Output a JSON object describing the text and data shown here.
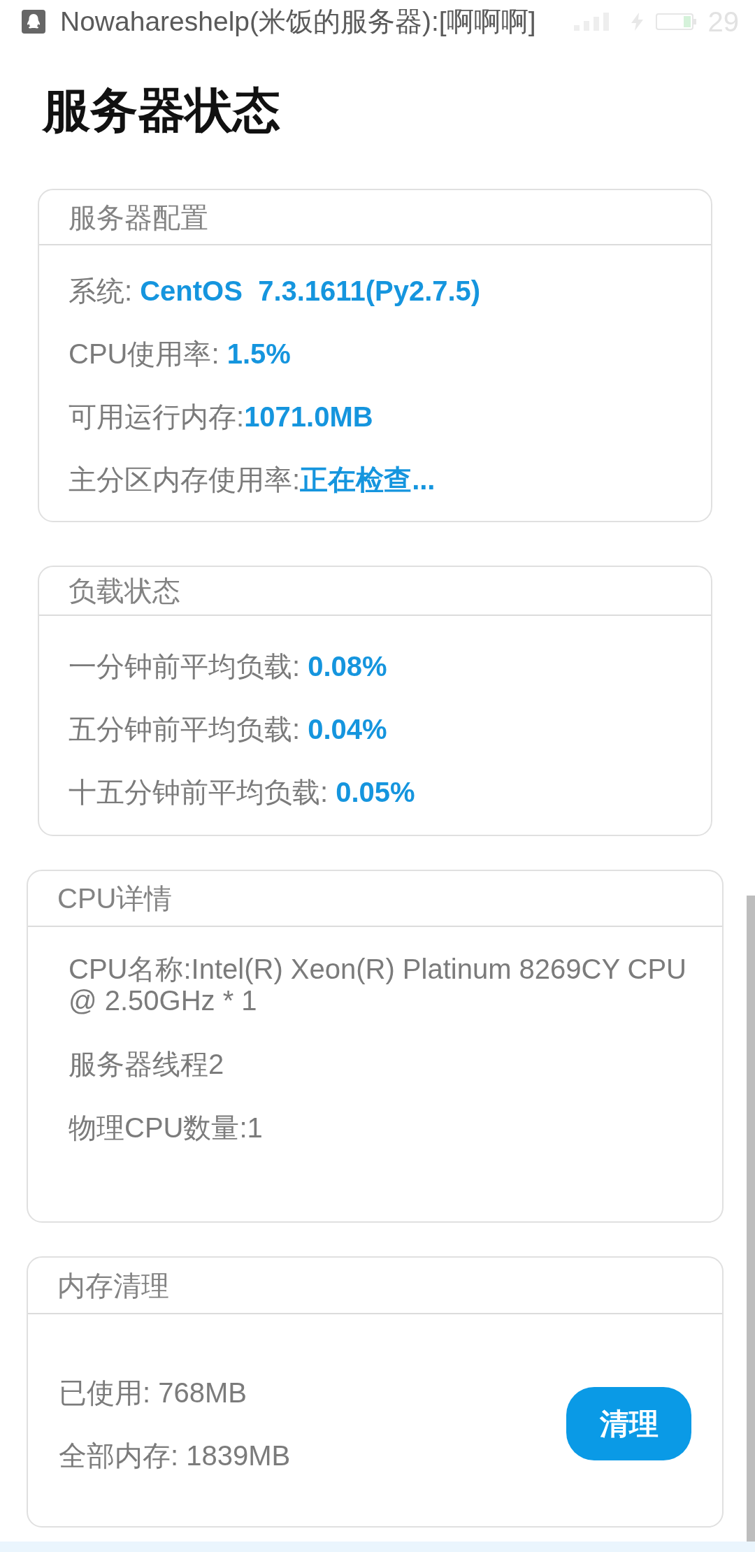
{
  "status_bar": {
    "notification": "Nowahareshelp(米饭的服务器):[啊啊啊]",
    "battery_percent": "29"
  },
  "page_title": "服务器状态",
  "cards": [
    {
      "kind": "fields",
      "title": "服务器配置",
      "rows": [
        {
          "label": "系统: ",
          "value": "CentOS  7.3.1611(Py2.7.5)"
        },
        {
          "label": "CPU使用率: ",
          "value": "1.5%"
        },
        {
          "label": "可用运行内存:",
          "value": "1071.0MB"
        },
        {
          "label": "主分区内存使用率:",
          "value": "正在检查..."
        }
      ]
    },
    {
      "kind": "fields",
      "title": "负载状态",
      "rows": [
        {
          "label": "一分钟前平均负载: ",
          "value": "0.08%"
        },
        {
          "label": "五分钟前平均负载: ",
          "value": "0.04%"
        },
        {
          "label": "十五分钟前平均负载: ",
          "value": "0.05%"
        }
      ]
    },
    {
      "kind": "lines",
      "title": "CPU详情",
      "lines": [
        "CPU名称:Intel(R) Xeon(R) Platinum 8269CY CPU @ 2.50GHz * 1",
        "服务器线程2",
        "物理CPU数量:1"
      ]
    },
    {
      "kind": "cleanup",
      "title": "内存清理",
      "lines": [
        "已使用: 768MB",
        "全部内存: 1839MB"
      ],
      "button": "清理"
    }
  ]
}
